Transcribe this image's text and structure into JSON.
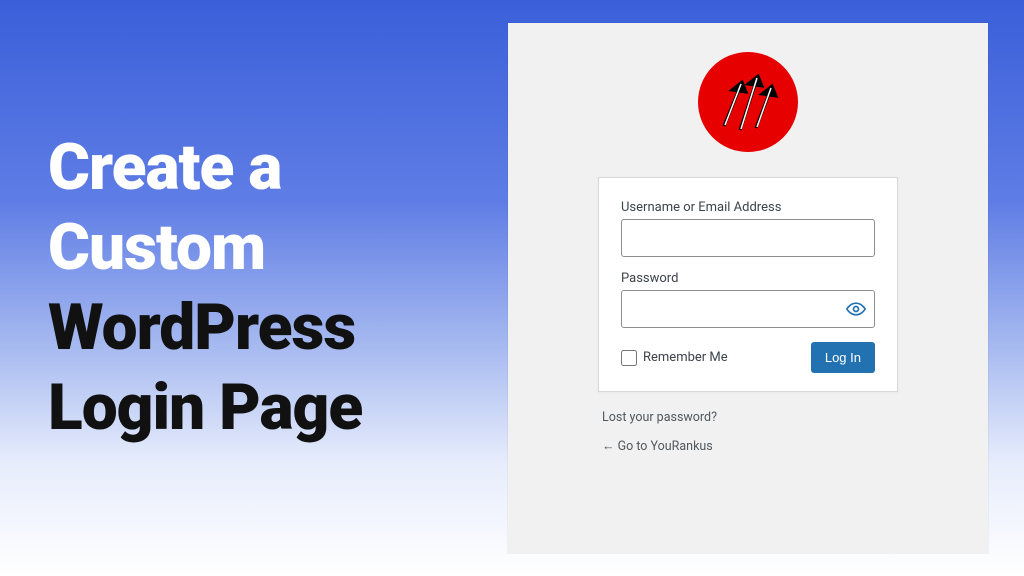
{
  "hero": {
    "line1": "Create a",
    "line2": "Custom",
    "line3": "WordPress",
    "line4": "Login Page"
  },
  "login": {
    "username_label": "Username or Email Address",
    "password_label": "Password",
    "remember_label": "Remember Me",
    "submit_label": "Log In",
    "lost_password": "Lost your password?",
    "back_link": "← Go to YouRankus"
  },
  "colors": {
    "logo_red": "#e60000",
    "button_blue": "#2271b1"
  }
}
